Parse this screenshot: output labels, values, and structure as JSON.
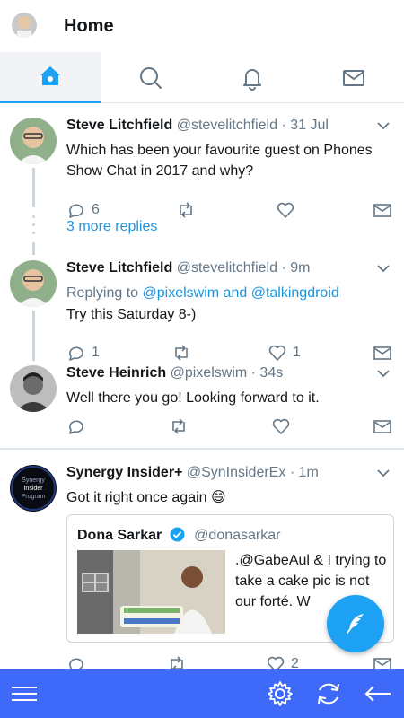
{
  "header": {
    "title": "Home",
    "avatar_icon": "user-avatar"
  },
  "tabs": [
    {
      "name": "home",
      "icon": "home-icon",
      "active": true
    },
    {
      "name": "search",
      "icon": "search-icon",
      "active": false
    },
    {
      "name": "notifications",
      "icon": "bell-icon",
      "active": false
    },
    {
      "name": "messages",
      "icon": "mail-icon",
      "active": false
    }
  ],
  "tweets": [
    {
      "name": "Steve Litchfield",
      "handle": "@stevelitchfield",
      "time": "· 31 Jul",
      "text": "Which has been your favourite guest on Phones Show Chat in 2017 and why?",
      "replies": "6",
      "retweets": "",
      "likes": ""
    },
    {
      "name": "Steve Litchfield",
      "handle": "@stevelitchfield",
      "time": "· 9m",
      "replying_prefix": "Replying to",
      "replying_mention1": "@pixelswim",
      "replying_and": "and",
      "replying_mention2": "@talkingdroid",
      "text": "Try this Saturday 8-)",
      "replies": "1",
      "retweets": "",
      "likes": "1"
    },
    {
      "name": "Steve Heinrich",
      "handle": "@pixelswim",
      "time": "· 34s",
      "text": "Well there you go! Looking forward to it.",
      "replies": "",
      "retweets": "",
      "likes": ""
    },
    {
      "name": "Synergy Insider+",
      "handle": "@SynInsiderEx",
      "time": "· 1m",
      "text": "Got it right once again 😄",
      "avatar_text": [
        "Synergy",
        "Insider",
        "Program"
      ],
      "replies": "",
      "retweets": "",
      "likes": "2"
    }
  ],
  "more_replies": "3 more replies",
  "quote": {
    "name": "Dona Sarkar",
    "handle": "@donasarkar",
    "text": ".@GabeAul & I trying to take a cake pic is not our forté. W"
  },
  "colors": {
    "accent": "#1da1f2",
    "link": "#1b95e0",
    "bottombar": "#3f6af9",
    "muted": "#657786"
  },
  "bottombar": [
    "menu-icon",
    "settings-icon",
    "refresh-icon",
    "back-icon"
  ]
}
